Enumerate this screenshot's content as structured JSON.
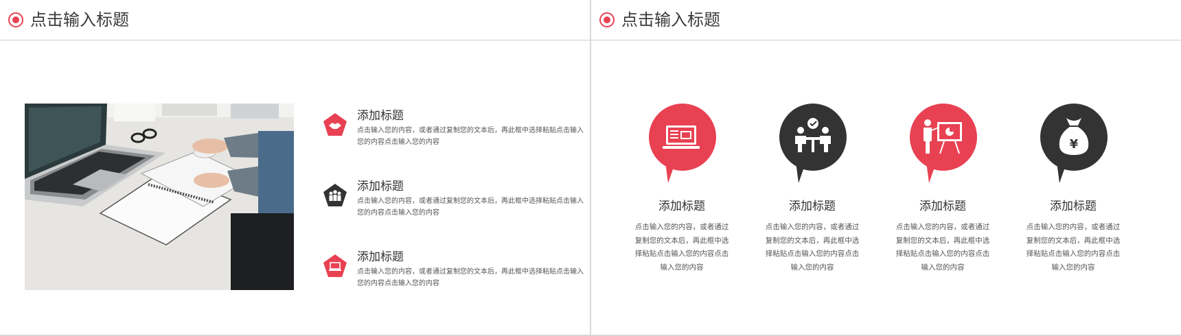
{
  "left_slide": {
    "header_title": "点击输入标题",
    "items": [
      {
        "title": "添加标题",
        "desc": "点击输入您的内容，或者通过复制您的文本后，再此框中选择粘贴点击输入您的内容点击输入您的内容",
        "icon": "handshake-icon",
        "color": "#e84152"
      },
      {
        "title": "添加标题",
        "desc": "点击输入您的内容，或者通过复制您的文本后，再此框中选择粘贴点击输入您的内容点击输入您的内容",
        "icon": "team-icon",
        "color": "#333333"
      },
      {
        "title": "添加标题",
        "desc": "点击输入您的内容，或者通过复制您的文本后，再此框中选择粘贴点击输入您的内容点击输入您的内容",
        "icon": "laptop-icon",
        "color": "#e84152"
      }
    ]
  },
  "right_slide": {
    "header_title": "点击输入标题",
    "cards": [
      {
        "title": "添加标题",
        "desc": "点击输入您的内容，或者通过复制您的文本后，再此框中选择粘贴点击输入您的内容点击输入您的内容",
        "icon": "laptop-icon",
        "color": "#e84152"
      },
      {
        "title": "添加标题",
        "desc": "点击输入您的内容，或者通过复制您的文本后，再此框中选择粘贴点击输入您的内容点击输入您的内容",
        "icon": "meeting-icon",
        "color": "#333333"
      },
      {
        "title": "添加标题",
        "desc": "点击输入您的内容，或者通过复制您的文本后，再此框中选择粘贴点击输入您的内容点击输入您的内容",
        "icon": "presentation-icon",
        "color": "#e84152"
      },
      {
        "title": "添加标题",
        "desc": "点击输入您的内容，或者通过复制您的文本后，再此框中选择粘贴点击输入您的内容点击输入您的内容",
        "icon": "money-bag-icon",
        "color": "#333333"
      }
    ]
  },
  "colors": {
    "accent": "#e84152",
    "dark": "#333333"
  }
}
